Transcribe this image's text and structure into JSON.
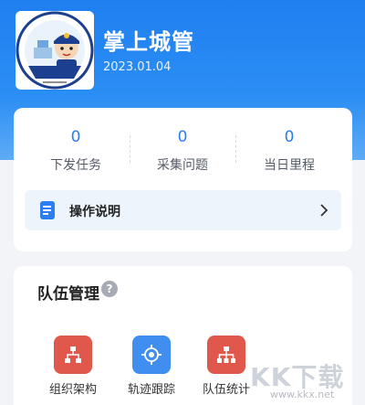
{
  "header": {
    "app_title": "掌上城管",
    "date": "2023.01.04",
    "logo": {
      "icon": "police-mascot-logo",
      "text": "NANNING URBAN M"
    },
    "colors": {
      "primary": "#1f7ff0"
    }
  },
  "stats": [
    {
      "value": "0",
      "label": "下发任务"
    },
    {
      "value": "0",
      "label": "采集问题"
    },
    {
      "value": "0",
      "label": "当日里程"
    }
  ],
  "guide": {
    "label": "操作说明",
    "icon": "document-icon",
    "chevron": "chevron-right-icon"
  },
  "team": {
    "title": "队伍管理",
    "help_icon": "?",
    "tools": [
      {
        "label": "组织架构",
        "icon": "org-chart-icon",
        "color": "#e0574b"
      },
      {
        "label": "轨迹跟踪",
        "icon": "location-target-icon",
        "color": "#3f8ef0"
      },
      {
        "label": "队伍统计",
        "icon": "hierarchy-icon",
        "color": "#e0574b"
      }
    ]
  },
  "watermark": {
    "text": "KK下载",
    "url": "www.kkx.net"
  }
}
